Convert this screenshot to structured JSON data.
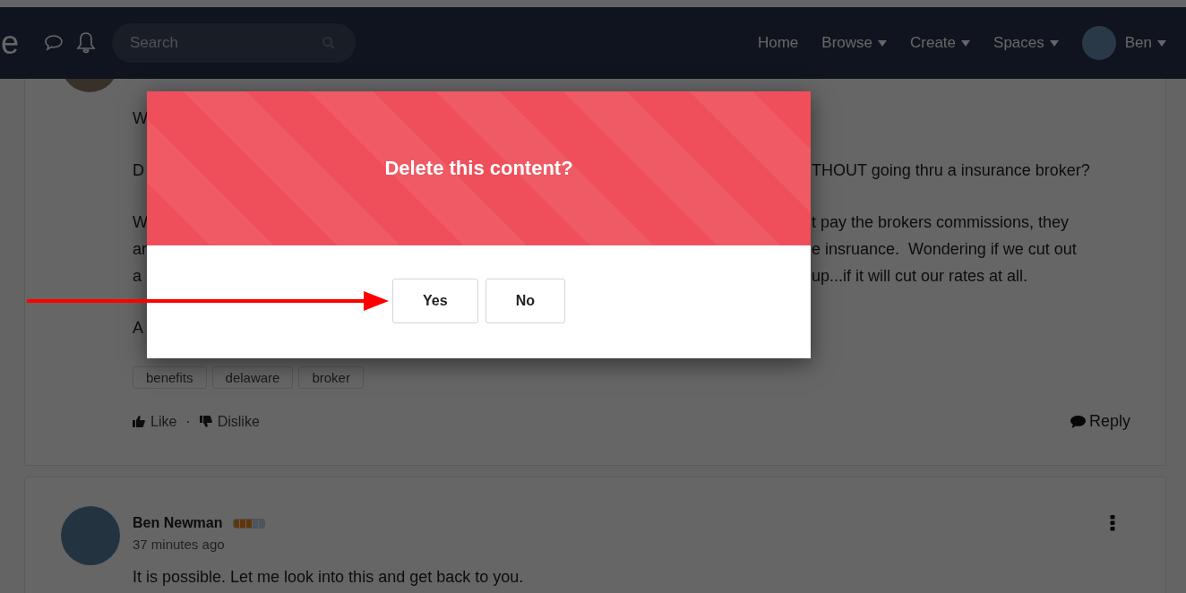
{
  "navbar": {
    "logo_fragment": "e",
    "search": {
      "placeholder": "Search"
    },
    "links": [
      {
        "label": "Home",
        "dropdown": false
      },
      {
        "label": "Browse",
        "dropdown": true
      },
      {
        "label": "Create",
        "dropdown": true
      },
      {
        "label": "Spaces",
        "dropdown": true
      }
    ],
    "user": {
      "name": "Ben",
      "dropdown": true
    }
  },
  "post": {
    "paragraphs": [
      {
        "lines": [
          {
            "left": "W"
          }
        ]
      },
      {
        "lines": [
          {
            "left": "D",
            "right": "THOUT going thru a insurance broker?"
          }
        ]
      },
      {
        "lines": [
          {
            "left": "W",
            "right": "t pay the brokers commissions, they"
          },
          {
            "left": "ar",
            "right": "e insruance.  Wondering if we cut out"
          },
          {
            "left": "a",
            "right": "up...if it will cut our rates at all."
          }
        ]
      },
      {
        "lines": [
          {
            "left": "A"
          }
        ]
      }
    ],
    "tags": [
      "benefits",
      "delaware",
      "broker"
    ],
    "actions": {
      "like": "Like",
      "separator": "·",
      "dislike": "Dislike",
      "reply": "Reply"
    }
  },
  "comment": {
    "author": "Ben Newman",
    "rank": {
      "level": 0.6
    },
    "time": "37 minutes ago",
    "text": "It is possible. Let me look into this and get back to you."
  },
  "dialog": {
    "title": "Delete this content?",
    "buttons": [
      "Yes",
      "No"
    ]
  }
}
